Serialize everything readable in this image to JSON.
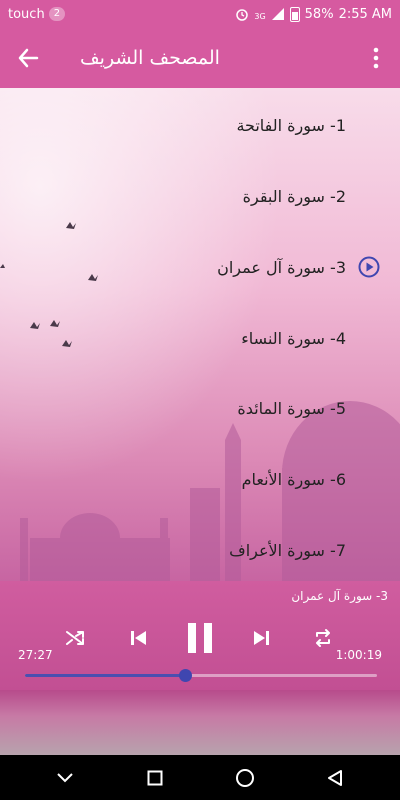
{
  "status_bar": {
    "carrier": "touch",
    "notification_count": "2",
    "network": "3G",
    "battery_percent": "58%",
    "time": "2:55 AM"
  },
  "app_bar": {
    "title": "المصحف الشريف",
    "back_icon": "arrow-back-icon",
    "menu_icon": "more-vertical-icon"
  },
  "surahs": [
    {
      "label": "1- سورة الفاتحة",
      "playing": false
    },
    {
      "label": "2- سورة البقرة",
      "playing": false
    },
    {
      "label": "3- سورة آل عمران",
      "playing": true
    },
    {
      "label": "4- سورة النساء",
      "playing": false
    },
    {
      "label": "5- سورة المائدة",
      "playing": false
    },
    {
      "label": "6- سورة الأنعام",
      "playing": false
    },
    {
      "label": "7-  سورة الأعراف",
      "playing": false
    }
  ],
  "player": {
    "now_playing": "3- سورة آل عمران",
    "elapsed": "27:27",
    "duration": "1:00:19",
    "progress": 0.455,
    "accent_color": "#3f46b0"
  },
  "colors": {
    "app_bar": "#d65aa0",
    "player": "#c24f93"
  }
}
